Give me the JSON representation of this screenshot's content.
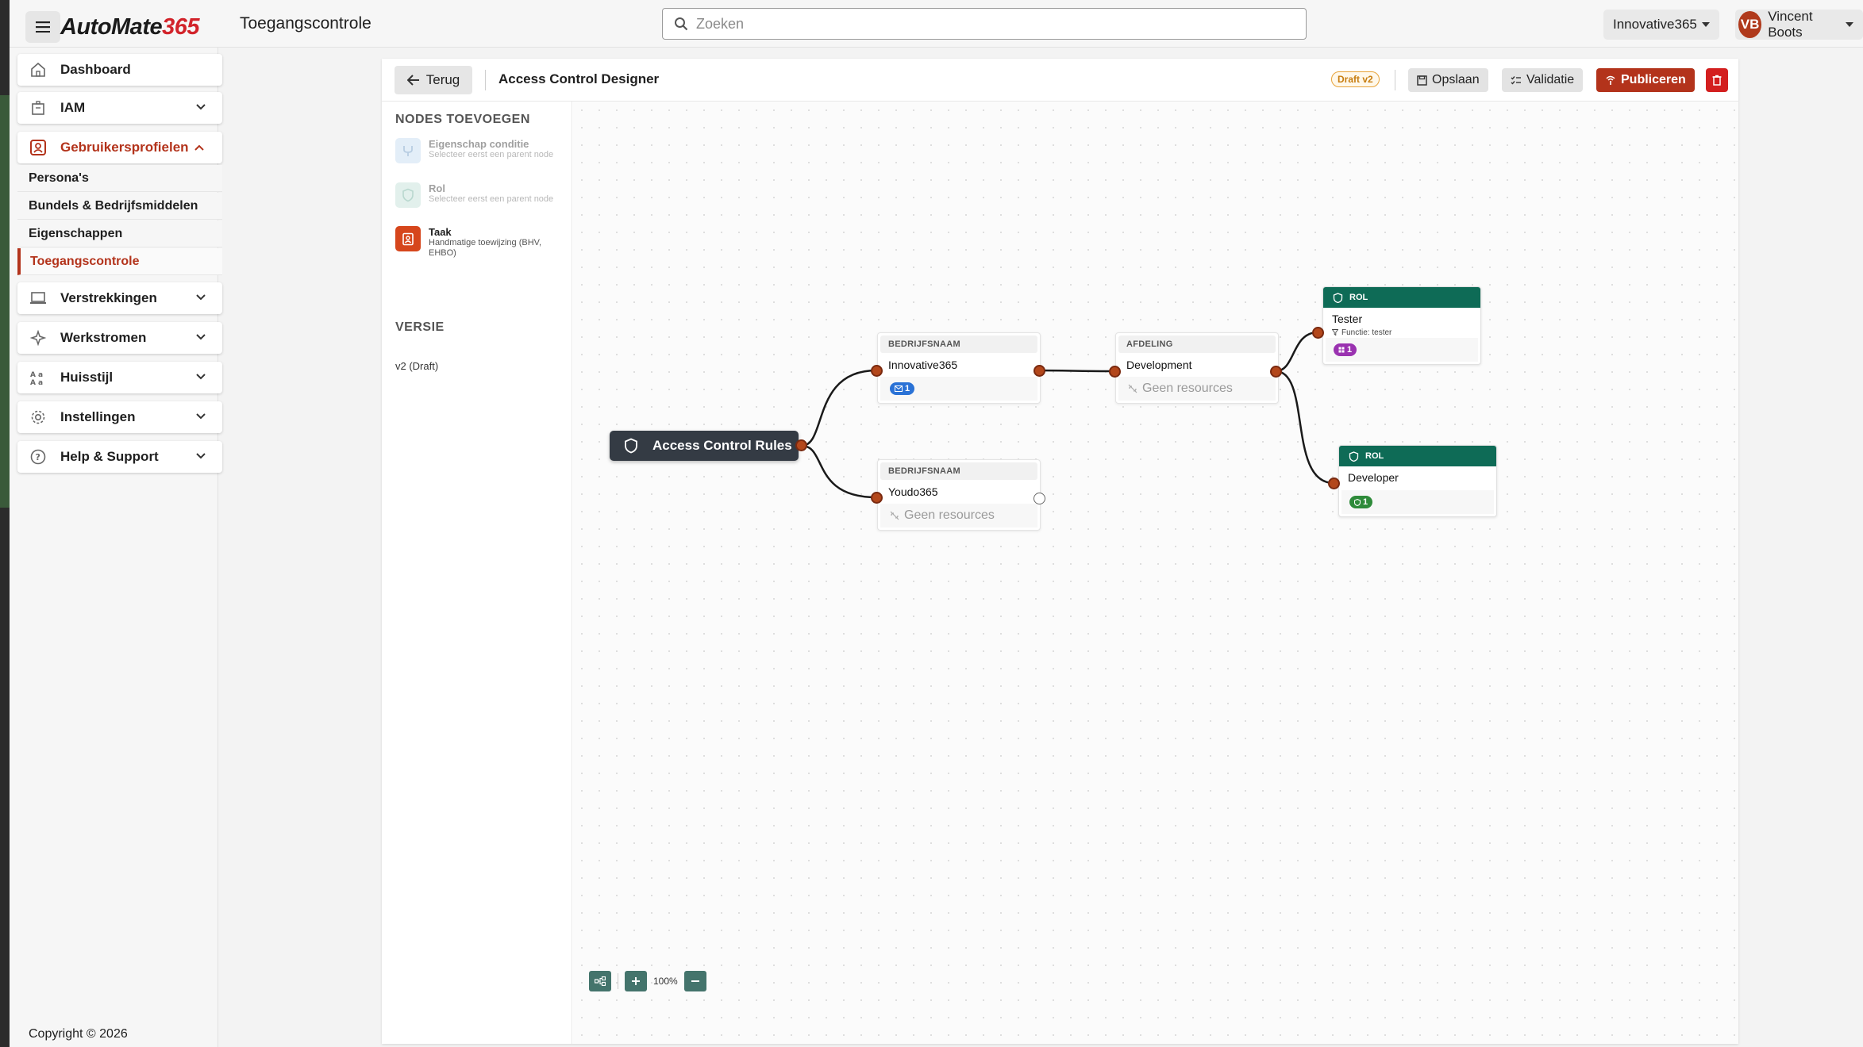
{
  "app": {
    "logo_part1": "AutoMate",
    "logo_part2": "365",
    "page_title": "Toegangscontrole"
  },
  "search": {
    "placeholder": "Zoeken"
  },
  "tenant": {
    "label": "Innovative365"
  },
  "user": {
    "initials": "VB",
    "name": "Vincent Boots"
  },
  "sidebar": {
    "items": [
      {
        "label": "Dashboard",
        "icon": "home-icon"
      },
      {
        "label": "IAM",
        "icon": "building-icon"
      },
      {
        "label": "Gebruikersprofielen",
        "icon": "user-profile-icon",
        "expanded": true
      },
      {
        "label": "Verstrekkingen",
        "icon": "laptop-icon"
      },
      {
        "label": "Werkstromen",
        "icon": "sparkle-icon"
      },
      {
        "label": "Huisstijl",
        "icon": "font-style-icon"
      },
      {
        "label": "Instellingen",
        "icon": "gear-icon"
      },
      {
        "label": "Help & Support",
        "icon": "help-icon"
      }
    ],
    "subitems": [
      {
        "label": "Persona's"
      },
      {
        "label": "Bundels & Bedrijfsmiddelen"
      },
      {
        "label": "Eigenschappen"
      },
      {
        "label": "Toegangscontrole",
        "selected": true
      }
    ],
    "copyright": "Copyright © 2026"
  },
  "designer": {
    "back_label": "Terug",
    "title": "Access Control Designer",
    "draft_badge": "Draft v2",
    "save_label": "Opslaan",
    "validate_label": "Validatie",
    "publish_label": "Publiceren",
    "colors": {
      "accent": "#b3331b",
      "role_header": "#0e6b56",
      "root_node": "#343b44",
      "delete": "#d31f1f"
    }
  },
  "palette": {
    "heading": "NODES TOEVOEGEN",
    "items": [
      {
        "title": "Eigenschap conditie",
        "desc": "Selecteer eerst een parent node",
        "enabled": false
      },
      {
        "title": "Rol",
        "desc": "Selecteer eerst een parent node",
        "enabled": false
      },
      {
        "title": "Taak",
        "desc": "Handmatige toewijzing (BHV, EHBO)",
        "enabled": true
      }
    ],
    "version_heading": "VERSIE",
    "version_value": "v2 (Draft)"
  },
  "canvas": {
    "root": {
      "label": "Access Control Rules"
    },
    "conditions": [
      {
        "type": "BEDRIJFSNAAM",
        "value": "Innovative365",
        "badge": "1"
      },
      {
        "type": "BEDRIJFSNAAM",
        "value": "Youdo365",
        "empty": "Geen resources"
      },
      {
        "type": "AFDELING",
        "value": "Development",
        "empty": "Geen resources"
      }
    ],
    "roles": [
      {
        "type": "ROL",
        "name": "Tester",
        "sub": "Functie: tester",
        "badge": "1"
      },
      {
        "type": "ROL",
        "name": "Developer",
        "badge": "1"
      }
    ],
    "zoom": "100%"
  }
}
